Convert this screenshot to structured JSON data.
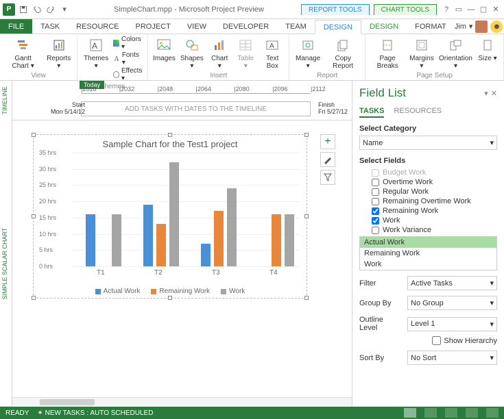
{
  "window": {
    "filename": "SimpleChart.mpp - Microsoft Project Preview",
    "context_tabs": {
      "report": "REPORT TOOLS",
      "chart": "CHART TOOLS"
    },
    "user": "Jim"
  },
  "tabs": {
    "file": "FILE",
    "task": "TASK",
    "resource": "RESOURCE",
    "project": "PROJECT",
    "view": "VIEW",
    "developer": "DEVELOPER",
    "team": "TEAM",
    "design_rt": "DESIGN",
    "design_ct": "DESIGN",
    "format": "FORMAT"
  },
  "ribbon": {
    "groups": {
      "view": "View",
      "themes": "Themes",
      "insert": "Insert",
      "report": "Report",
      "page_setup": "Page Setup"
    },
    "buttons": {
      "gantt": "Gantt Chart ▾",
      "reports": "Reports ▾",
      "themes": "Themes ▾",
      "colors": "Colors ▾",
      "fonts": "Fonts ▾",
      "effects": "Effects ▾",
      "images": "Images",
      "shapes": "Shapes ▾",
      "chart": "Chart ▾",
      "table": "Table ▾",
      "textbox": "Text Box",
      "manage": "Manage ▾",
      "copy": "Copy Report",
      "pagebreaks": "Page Breaks",
      "margins": "Margins ▾",
      "orientation": "Orientation ▾",
      "size": "Size ▾"
    }
  },
  "timeline": {
    "today": "Today",
    "ticks": [
      "2016",
      "2032",
      "2048",
      "2064",
      "2080",
      "2096",
      "2112"
    ],
    "start_label": "Start",
    "start_date": "Mon 5/14/12",
    "finish_label": "Finish",
    "finish_date": "Fri 5/27/12",
    "placeholder": "ADD TASKS WITH DATES TO THE TIMELINE"
  },
  "vtabs": {
    "timeline": "TIMELINE",
    "chart": "SIMPLE SCALAR CHART"
  },
  "chart_data": {
    "type": "bar",
    "title": "Sample Chart for the Test1 project",
    "categories": [
      "T1",
      "T2",
      "T3",
      "T4"
    ],
    "series": [
      {
        "name": "Actual Work",
        "color": "#4a90d9",
        "values": [
          16,
          19,
          7,
          0
        ]
      },
      {
        "name": "Remaining Work",
        "color": "#e8873a",
        "values": [
          0,
          13,
          17,
          16
        ]
      },
      {
        "name": "Work",
        "color": "#a5a5a5",
        "values": [
          16,
          32,
          24,
          16
        ]
      }
    ],
    "ylabel_suffix": " hrs",
    "yticks": [
      0,
      5,
      10,
      15,
      20,
      25,
      30,
      35
    ],
    "ylim": [
      0,
      35
    ]
  },
  "fieldlist": {
    "title": "Field List",
    "tabs": {
      "tasks": "TASKS",
      "resources": "RESOURCES"
    },
    "select_category_label": "Select Category",
    "category_select": "Name",
    "select_fields_label": "Select Fields",
    "checks": [
      {
        "label": "Budget Work",
        "checked": false,
        "cutoff": true
      },
      {
        "label": "Overtime Work",
        "checked": false
      },
      {
        "label": "Regular Work",
        "checked": false
      },
      {
        "label": "Remaining Overtime Work",
        "checked": false
      },
      {
        "label": "Remaining Work",
        "checked": true
      },
      {
        "label": "Work",
        "checked": true
      },
      {
        "label": "Work Variance",
        "checked": false
      }
    ],
    "listbox": [
      "Actual Work",
      "Remaining Work",
      "Work"
    ],
    "listbox_selected": 0,
    "filter_label": "Filter",
    "filter_value": "Active Tasks",
    "groupby_label": "Group By",
    "groupby_value": "No Group",
    "outline_label": "Outline Level",
    "outline_value": "Level 1",
    "show_hier_label": "Show Hierarchy",
    "show_hier_checked": false,
    "sortby_label": "Sort By",
    "sortby_value": "No Sort"
  },
  "status": {
    "ready": "READY",
    "newtasks": "NEW TASKS : AUTO SCHEDULED"
  }
}
